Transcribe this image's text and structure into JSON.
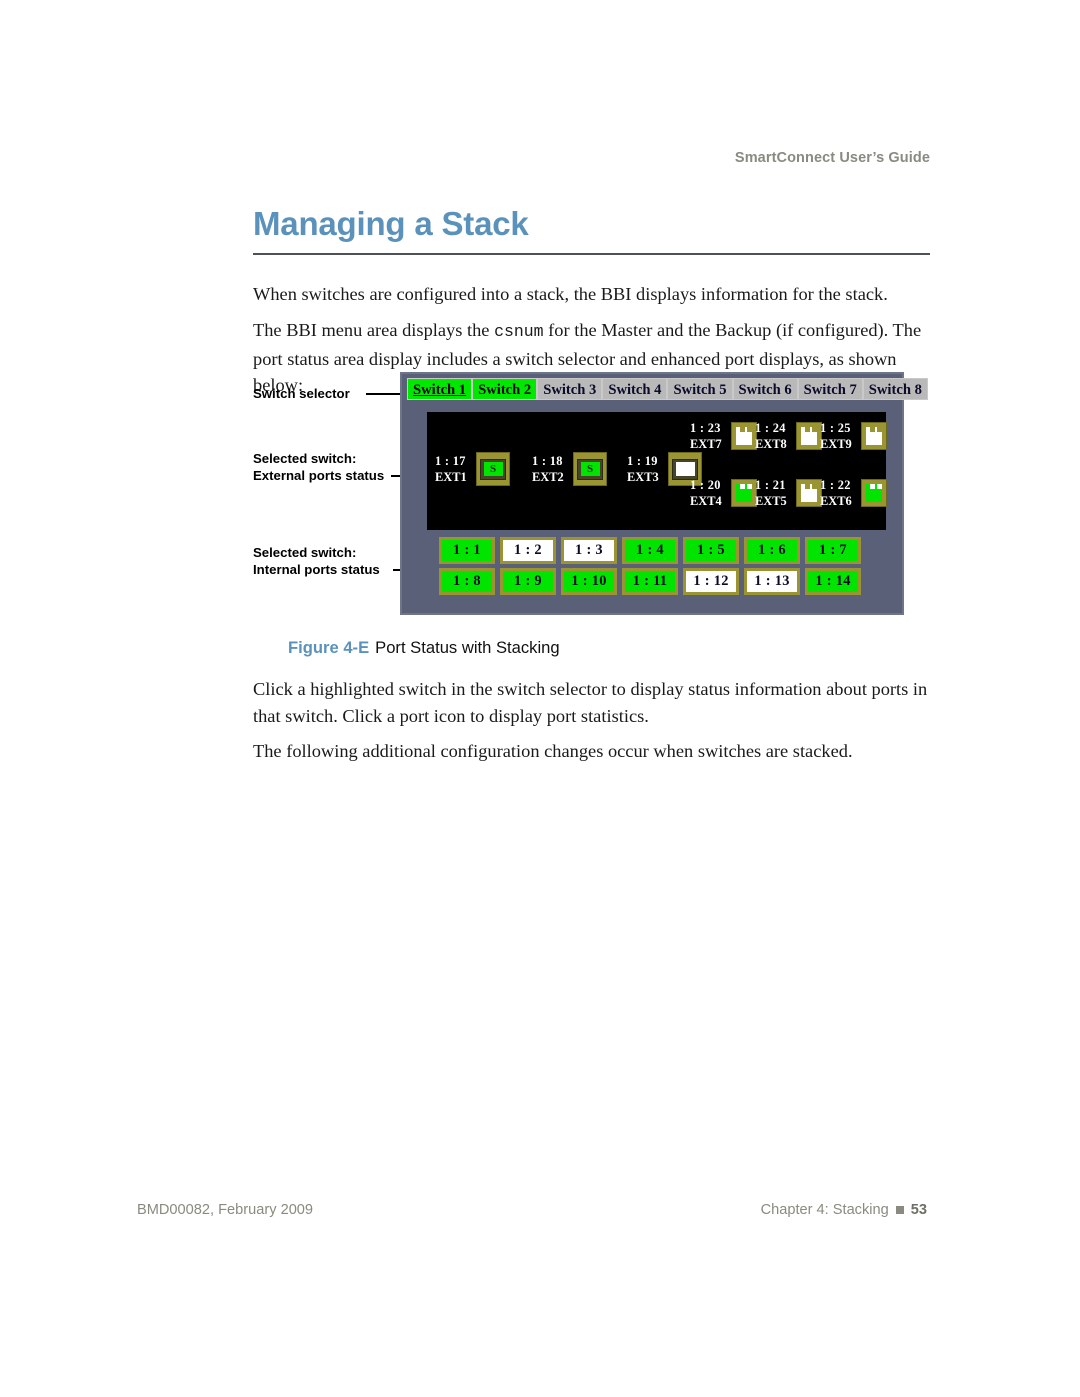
{
  "header": {
    "running_head": "SmartConnect User’s Guide"
  },
  "title": {
    "text": "Managing a Stack"
  },
  "paragraphs": {
    "p1": "When switches are configured into a stack, the BBI displays information for the stack.",
    "p2_a": "The BBI menu area displays the ",
    "p2_code": "csnum",
    "p2_b": " for the Master and the Backup (if configured). The port status area display includes a switch selector and enhanced port displays, as shown below:",
    "p3": "Click a highlighted switch in the switch selector to display status information about ports in that switch. Click a port icon to display port statistics.",
    "p4": "The following additional configuration changes occur when switches are stacked."
  },
  "figure": {
    "annotations": [
      {
        "line1": "Switch selector",
        "line2": ""
      },
      {
        "line1": "Selected switch:",
        "line2": "External ports status"
      },
      {
        "line1": "Selected switch:",
        "line2": "Internal ports status"
      }
    ],
    "switch_selector": [
      {
        "label": "Switch 1",
        "state": "active-current"
      },
      {
        "label": "Switch 2",
        "state": "active"
      },
      {
        "label": "Switch 3",
        "state": "inactive"
      },
      {
        "label": "Switch 4",
        "state": "inactive"
      },
      {
        "label": "Switch 5",
        "state": "inactive"
      },
      {
        "label": "Switch 6",
        "state": "inactive"
      },
      {
        "label": "Switch 7",
        "state": "inactive"
      },
      {
        "label": "Switch 8",
        "state": "inactive"
      }
    ],
    "external_ports_large": [
      {
        "num": "1 : 17",
        "name": "EXT1",
        "state": "green",
        "glyph": "S"
      },
      {
        "num": "1 : 18",
        "name": "EXT2",
        "state": "green",
        "glyph": "S"
      },
      {
        "num": "1 : 19",
        "name": "EXT3",
        "state": "white",
        "glyph": ""
      }
    ],
    "external_ports_small_top": [
      {
        "num": "1 : 23",
        "name": "EXT7",
        "state": "white"
      },
      {
        "num": "1 : 24",
        "name": "EXT8",
        "state": "white"
      },
      {
        "num": "1 : 25",
        "name": "EXT9",
        "state": "white"
      }
    ],
    "external_ports_small_bottom": [
      {
        "num": "1 : 20",
        "name": "EXT4",
        "state": "green"
      },
      {
        "num": "1 : 21",
        "name": "EXT5",
        "state": "white"
      },
      {
        "num": "1 : 22",
        "name": "EXT6",
        "state": "green"
      }
    ],
    "internal_ports_row1": [
      {
        "label": "1 : 1",
        "state": "green"
      },
      {
        "label": "1 : 2",
        "state": "white"
      },
      {
        "label": "1 : 3",
        "state": "white"
      },
      {
        "label": "1 : 4",
        "state": "green"
      },
      {
        "label": "1 : 5",
        "state": "green"
      },
      {
        "label": "1 : 6",
        "state": "green"
      },
      {
        "label": "1 : 7",
        "state": "green"
      }
    ],
    "internal_ports_row2": [
      {
        "label": "1 : 8",
        "state": "green"
      },
      {
        "label": "1 : 9",
        "state": "green"
      },
      {
        "label": "1 : 10",
        "state": "green"
      },
      {
        "label": "1 : 11",
        "state": "green"
      },
      {
        "label": "1 : 12",
        "state": "white"
      },
      {
        "label": "1 : 13",
        "state": "white"
      },
      {
        "label": "1 : 14",
        "state": "green"
      }
    ],
    "caption_number": "Figure 4-E",
    "caption_title": "Port Status with Stacking"
  },
  "footer": {
    "left": "BMD00082, February 2009",
    "chapter": "Chapter 4: Stacking",
    "page": "53"
  },
  "colors": {
    "title_blue": "#5b92bc",
    "panel_gray": "#5a6078",
    "port_green": "#00e400",
    "port_white": "#ffffff",
    "bezel_olive": "#9a9432",
    "header_gray": "#8a8a80"
  }
}
